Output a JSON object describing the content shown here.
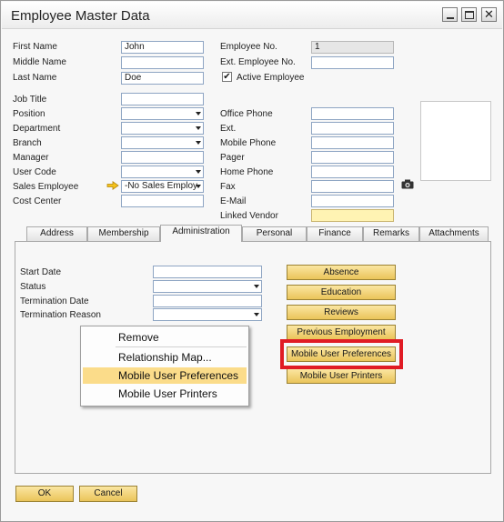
{
  "window": {
    "title": "Employee Master Data"
  },
  "left_fields": [
    {
      "label": "First Name",
      "value": "John"
    },
    {
      "label": "Middle Name",
      "value": ""
    },
    {
      "label": "Last Name",
      "value": "Doe"
    }
  ],
  "right_fields": [
    {
      "label": "Employee No.",
      "value": "1"
    },
    {
      "label": "Ext. Employee No.",
      "value": ""
    }
  ],
  "active_employee": {
    "label": "Active Employee",
    "checked": true,
    "mark": "✔"
  },
  "job_fields": [
    {
      "label": "Job Title",
      "value": ""
    },
    {
      "label": "Position",
      "value": ""
    },
    {
      "label": "Department",
      "value": ""
    },
    {
      "label": "Branch",
      "value": ""
    },
    {
      "label": "Manager",
      "value": ""
    },
    {
      "label": "User Code",
      "value": ""
    },
    {
      "label": "Sales Employee",
      "value": "-No Sales Employ"
    },
    {
      "label": "Cost Center",
      "value": ""
    }
  ],
  "contact_fields": [
    {
      "label": "Office Phone",
      "value": ""
    },
    {
      "label": "Ext.",
      "value": ""
    },
    {
      "label": "Mobile Phone",
      "value": ""
    },
    {
      "label": "Pager",
      "value": ""
    },
    {
      "label": "Home Phone",
      "value": ""
    },
    {
      "label": "Fax",
      "value": ""
    },
    {
      "label": "E-Mail",
      "value": ""
    },
    {
      "label": "Linked Vendor",
      "value": ""
    }
  ],
  "tabs": [
    "Address",
    "Membership",
    "Administration",
    "Personal",
    "Finance",
    "Remarks",
    "Attachments"
  ],
  "active_tab": "Administration",
  "admin_fields": [
    {
      "label": "Start Date",
      "value": ""
    },
    {
      "label": "Status",
      "value": ""
    },
    {
      "label": "Termination Date",
      "value": ""
    },
    {
      "label": "Termination Reason",
      "value": ""
    }
  ],
  "action_buttons": [
    "Absence",
    "Education",
    "Reviews",
    "Previous Employment",
    "Mobile User Preferences",
    "Mobile User Printers"
  ],
  "context_menu": {
    "items": [
      "Remove",
      "Relationship Map...",
      "Mobile User Preferences",
      "Mobile User Printers"
    ],
    "hovered": "Mobile User Preferences"
  },
  "footer": {
    "ok_label": "OK",
    "cancel_label": "Cancel"
  },
  "colors": {
    "highlight_border": "#e01b24",
    "button_yellow": "#eac45a",
    "menu_hover": "#fbdc8a"
  },
  "icons": {
    "sales_employee_link": "link-arrow-icon",
    "photo": "camera-icon"
  }
}
